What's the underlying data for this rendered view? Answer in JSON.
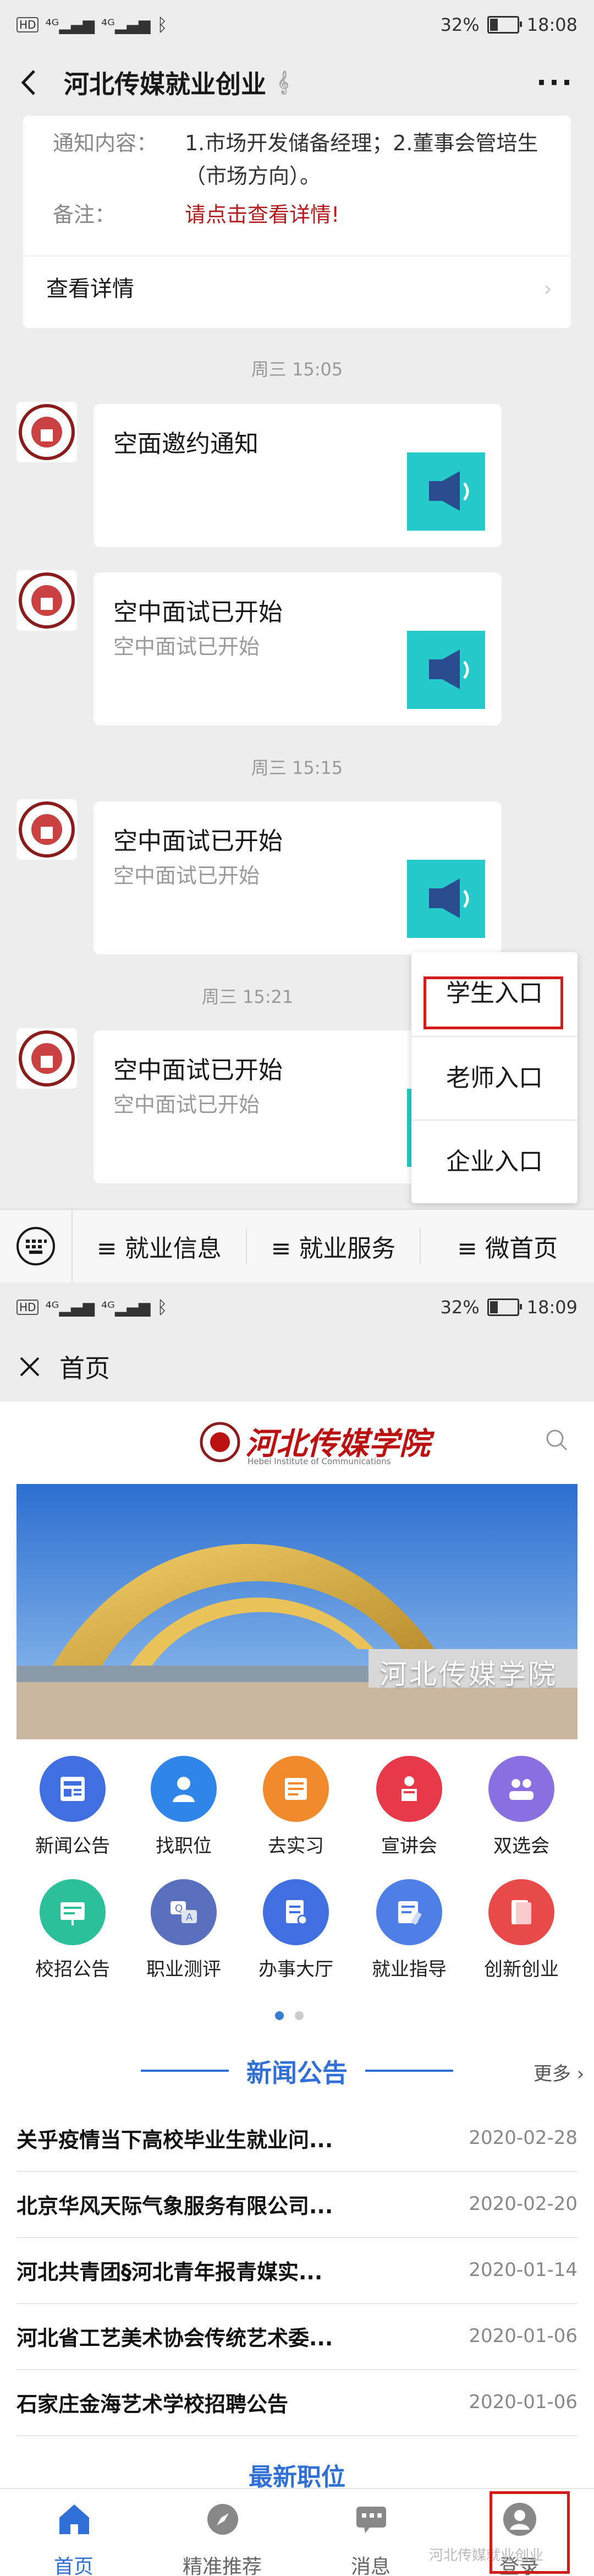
{
  "screen1": {
    "status": {
      "battery": "32%",
      "time": "18:08"
    },
    "title": "河北传媒就业创业",
    "notice": {
      "content_label": "通知内容：",
      "content_value": "1.市场开发储备经理；2.董事会管培生（市场方向）。",
      "remark_label": "备注：",
      "remark_value": "请点击查看详情!",
      "detail_link": "查看详情"
    },
    "messages": [
      {
        "time": "周三 15:05",
        "title": "空面邀约通知",
        "desc": ""
      },
      {
        "time": "",
        "title": "空中面试已开始",
        "desc": "空中面试已开始"
      },
      {
        "time": "周三 15:15",
        "title": "空中面试已开始",
        "desc": "空中面试已开始"
      },
      {
        "time": "周三 15:21",
        "title": "空中面试已开始",
        "desc": "空中面试已开始"
      }
    ],
    "popup_menu": [
      "学生入口",
      "老师入口",
      "企业入口"
    ],
    "bottom_menu": [
      "≡ 就业信息",
      "≡ 就业服务",
      "≡ 微首页"
    ]
  },
  "screen2": {
    "status": {
      "battery": "32%",
      "time": "18:09"
    },
    "title": "首页",
    "logo_text": "河北传媒学院",
    "logo_sub": "Hebei Institute of Communications",
    "banner_sign": "河北传媒学院",
    "grid": [
      {
        "label": "新闻公告",
        "color": "#3f6fe0",
        "icon": "newspaper-icon"
      },
      {
        "label": "找职位",
        "color": "#2f86e8",
        "icon": "person-search-icon"
      },
      {
        "label": "去实习",
        "color": "#f08a2c",
        "icon": "briefcase-icon"
      },
      {
        "label": "宣讲会",
        "color": "#e8394a",
        "icon": "speaker-icon"
      },
      {
        "label": "双选会",
        "color": "#8a6fe0",
        "icon": "handshake-icon"
      },
      {
        "label": "校招公告",
        "color": "#2bbf9a",
        "icon": "board-icon"
      },
      {
        "label": "职业测评",
        "color": "#5b6fbf",
        "icon": "qa-icon"
      },
      {
        "label": "办事大厅",
        "color": "#3f6fe0",
        "icon": "document-icon"
      },
      {
        "label": "就业指导",
        "color": "#4e7fe6",
        "icon": "guide-icon"
      },
      {
        "label": "创新创业",
        "color": "#e84a4a",
        "icon": "book-icon"
      }
    ],
    "section_title": "新闻公告",
    "more_label": "更多",
    "news": [
      {
        "title": "关乎疫情当下高校毕业生就业问...",
        "date": "2020-02-28"
      },
      {
        "title": "北京华风天际气象服务有限公司...",
        "date": "2020-02-20"
      },
      {
        "title": "河北共青团§河北青年报青媒实...",
        "date": "2020-01-14"
      },
      {
        "title": "河北省工艺美术协会传统艺术委...",
        "date": "2020-01-06"
      },
      {
        "title": "石家庄金海艺术学校招聘公告",
        "date": "2020-01-06"
      }
    ],
    "next_section": "最新职位",
    "tabs": [
      "首页",
      "精准推荐",
      "消息",
      "登录"
    ],
    "watermark": "河北传媒就业创业"
  }
}
